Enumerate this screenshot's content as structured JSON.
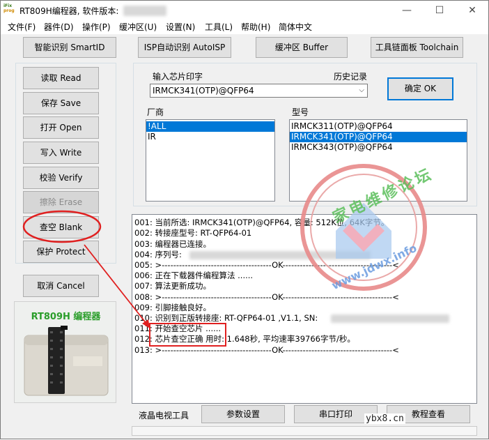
{
  "window": {
    "logo": [
      "iFix",
      "prog"
    ],
    "title": "RT809H编程器, 软件版本:",
    "minimize": "—",
    "maximize": "☐",
    "close": "✕"
  },
  "menu": [
    "文件(F)",
    "器件(D)",
    "操作(P)",
    "缓冲区(U)",
    "设置(N)",
    "工具(L)",
    "帮助(H)",
    "简体中文"
  ],
  "toolbar": {
    "smart_id": "智能识别 SmartID",
    "isp_auto": "ISP自动识别 AutoISP",
    "buffer": "缓冲区 Buffer",
    "toolchain": "工具链面板 Toolchain"
  },
  "actions": {
    "read": "读取 Read",
    "save": "保存 Save",
    "open": "打开 Open",
    "write": "写入 Write",
    "verify": "校验 Verify",
    "erase": "擦除 Erase",
    "blank": "查空 Blank",
    "protect": "保护 Protect",
    "cancel": "取消 Cancel"
  },
  "device_photo": {
    "caption": "RT809H 编程器"
  },
  "chip_input": {
    "label": "输入芯片印字",
    "history_label": "历史记录",
    "value": "IRMCK341(OTP)@QFP64",
    "ok": "确定 OK"
  },
  "vendor": {
    "label": "厂商",
    "items": [
      "!ALL",
      "IR"
    ],
    "selected": 0
  },
  "model": {
    "label": "型号",
    "items": [
      "IRMCK311(OTP)@QFP64",
      "IRMCK341(OTP)@QFP64",
      "IRMCK343(OTP)@QFP64"
    ],
    "selected": 1
  },
  "log": [
    "001: 当前所选: IRMCK341(OTP)@QFP64, 容量: 512K位, 64K字节。",
    "002: 转接座型号: RT-QFP64-01",
    "003: 编程器已连接。",
    "004: 序列号:",
    "005: >--------------------------------------OK--------------------------------------<",
    "006: 正在下载器件编程算法 ......",
    "007: 算法更新成功。",
    "008: >--------------------------------------OK--------------------------------------<",
    "009: 引脚接触良好。",
    "010: 识别到正版转接座: RT-QFP64-01 ,V1.1, SN:",
    "011: 开始查空芯片 ......",
    "012: 芯片查空正确  用时: 1.648秒, 平均速率39766字节/秒。",
    "013: >--------------------------------------OK--------------------------------------<"
  ],
  "bottom": {
    "lcd_tool": "液晶电视工具",
    "params": "参数设置",
    "serial": "串口打印",
    "tutorial": "教程查看"
  },
  "watermark": {
    "text": "家电维修论坛",
    "url": "www.jdwx.info",
    "site": "ybx8.cn"
  },
  "colors": {
    "selection": "#0078d7",
    "annotation": "#e02020",
    "primary_border": "#0078d7"
  }
}
